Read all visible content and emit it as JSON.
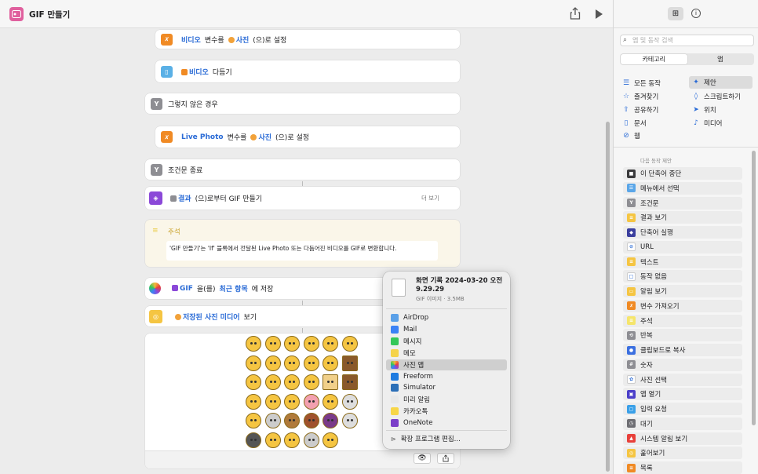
{
  "window": {
    "title": "GIF 만들기"
  },
  "canvas": {
    "rows": [
      {
        "token1": "비디오",
        "t1": "변수를",
        "token2": "사진",
        "t2": "(으)로 설정"
      },
      {
        "token1": "비디오",
        "t1": "다듬기"
      },
      {
        "t1": "그렇지 않은 경우"
      },
      {
        "token1": "Live Photo",
        "t1": "변수를",
        "token2": "사진",
        "t2": "(으)로 설정"
      },
      {
        "t1": "조건문 종료"
      },
      {
        "token1": "결과",
        "t1": "(으)로부터 GIF 만들기",
        "more": "더 보기"
      },
      {
        "token1": "GIF",
        "t1": "을(를)",
        "token2": "최근 항목",
        "t2": "에 저장"
      },
      {
        "token1": "저장된 사진 미디어",
        "t1": "보기"
      }
    ],
    "comment": {
      "label": "주석",
      "text": "'GIF 만들기'는 'If' 블록에서 전달된 Live Photo 또는 다듬어진 비디오를 GIF로 변환합니다."
    }
  },
  "popup": {
    "file_title": "화면 기록 2024-03-20 오전 9.29.29",
    "file_sub": "GIF 이미지 · 3.5MB",
    "items": [
      "AirDrop",
      "Mail",
      "메시지",
      "메모",
      "사진 앱",
      "Freeform",
      "Simulator",
      "미리 알림",
      "카카오톡",
      "OneNote"
    ],
    "item_colors": [
      "#5aa0e8",
      "#3b82f6",
      "#34c759",
      "#f5d34a",
      "#ffffff",
      "#1e7be0",
      "#2c6fb7",
      "#e8e8e8",
      "#f7d648",
      "#7b3fc9"
    ],
    "edit": "확장 프로그램 편집..."
  },
  "sidebar": {
    "search_placeholder": "앱 및 동작 검색",
    "seg": [
      "카테고리",
      "앱"
    ],
    "cats": [
      "모든 동작",
      "제안",
      "즐겨찾기",
      "스크립트하기",
      "공유하기",
      "위치",
      "문서",
      "미디어",
      "웹"
    ],
    "sugg_header": "다음 동작 제안",
    "suggestions": [
      "이 단축어 중단",
      "메뉴에서 선택",
      "조건문",
      "결과 보기",
      "단축어 실행",
      "URL",
      "텍스트",
      "동작 없음",
      "알림 보기",
      "변수 가져오기",
      "주석",
      "반복",
      "클립보드로 복사",
      "숫자",
      "사진 선택",
      "앱 열기",
      "입력 요청",
      "대기",
      "시스템 알림 보기",
      "훑어보기",
      "목록"
    ],
    "sugg_colors": [
      "#3a3a3c",
      "#5aa6e8",
      "#8e8e93",
      "#f5c542",
      "#3b3f9e",
      "#ffffff",
      "#f5c542",
      "#ffffff",
      "#f5c542",
      "#f08a24",
      "#f5e56b",
      "#8e8e93",
      "#3b6fe0",
      "#8e8e93",
      "#ffffff",
      "#4b3fc9",
      "#3aa0e8",
      "#6e6e73",
      "#e8403a",
      "#f5c542",
      "#f08a24"
    ]
  }
}
